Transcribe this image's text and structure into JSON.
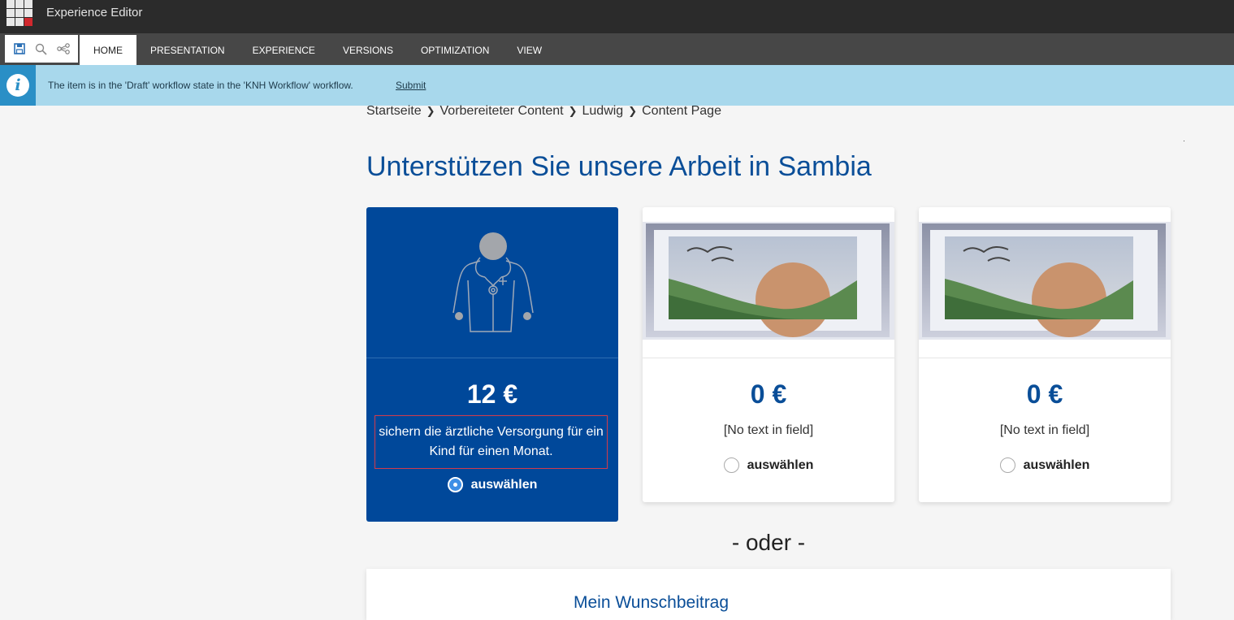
{
  "app": {
    "title": "Experience Editor",
    "icon": "app-grid-icon"
  },
  "quick_tools": [
    {
      "name": "save-icon"
    },
    {
      "name": "search-icon"
    },
    {
      "name": "navigation-tree-icon"
    }
  ],
  "tabs": [
    {
      "label": "HOME",
      "active": true
    },
    {
      "label": "PRESENTATION",
      "active": false
    },
    {
      "label": "EXPERIENCE",
      "active": false
    },
    {
      "label": "VERSIONS",
      "active": false
    },
    {
      "label": "OPTIMIZATION",
      "active": false
    },
    {
      "label": "VIEW",
      "active": false
    }
  ],
  "notification": {
    "icon": "info-icon",
    "text": "The item is in the 'Draft' workflow state in the 'KNH Workflow' workflow.",
    "link": "Submit"
  },
  "breadcrumb": [
    "Startseite",
    "Vorbereiteter Content",
    "Ludwig",
    "Content Page"
  ],
  "page_title": "Unterstützen Sie unsere Arbeit in Sambia",
  "cards": [
    {
      "amount": "12 €",
      "description": "sichern die ärztliche Versorgung für ein Kind für einen Monat.",
      "choose_label": "auswählen",
      "selected": true,
      "image": "doctor-icon"
    },
    {
      "amount": "0 €",
      "description": "[No text in field]",
      "choose_label": "auswählen",
      "selected": false,
      "image": "placeholder-landscape-image"
    },
    {
      "amount": "0 €",
      "description": "[No text in field]",
      "choose_label": "auswählen",
      "selected": false,
      "image": "placeholder-landscape-image"
    }
  ],
  "separator_text": "- oder -",
  "custom_amount": {
    "title": "Mein Wunschbeitrag"
  },
  "colors": {
    "topbar": "#2b2b2b",
    "ribbon": "#474747",
    "notice": "#a8d8ec",
    "brand_blue": "#00489a",
    "title_blue": "#0a4e98"
  }
}
